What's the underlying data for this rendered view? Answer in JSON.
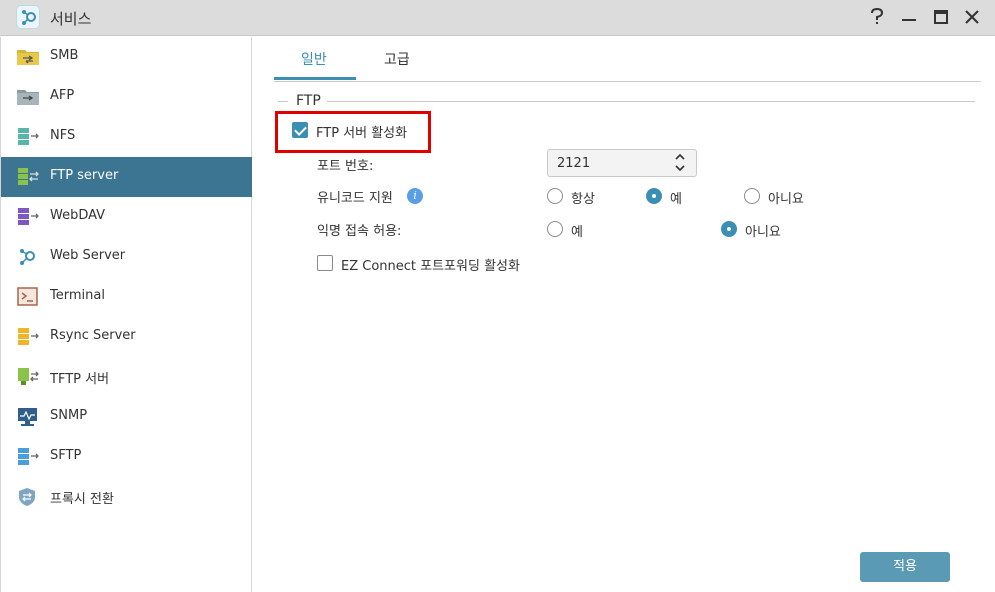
{
  "window": {
    "title": "서비스",
    "controls": [
      "help-icon",
      "minimize-icon",
      "maximize-icon",
      "close-icon"
    ]
  },
  "sidebar": {
    "items": [
      {
        "label": "SMB",
        "icon": "smb-folder-icon"
      },
      {
        "label": "AFP",
        "icon": "afp-folder-icon"
      },
      {
        "label": "NFS",
        "icon": "nfs-icon"
      },
      {
        "label": "FTP server",
        "icon": "ftp-icon",
        "active": true
      },
      {
        "label": "WebDAV",
        "icon": "webdav-icon"
      },
      {
        "label": "Web Server",
        "icon": "web-server-icon"
      },
      {
        "label": "Terminal",
        "icon": "terminal-icon"
      },
      {
        "label": "Rsync Server",
        "icon": "rsync-icon"
      },
      {
        "label": "TFTP 서버",
        "icon": "tftp-icon"
      },
      {
        "label": "SNMP",
        "icon": "snmp-icon"
      },
      {
        "label": "SFTP",
        "icon": "sftp-icon"
      },
      {
        "label": "프록시 전환",
        "icon": "proxy-shield-icon"
      }
    ]
  },
  "tabs": [
    {
      "label": "일반",
      "active": true
    },
    {
      "label": "고급",
      "active": false
    }
  ],
  "section": {
    "legend": "FTP",
    "enable_ftp": {
      "label": "FTP 서버 활성화",
      "checked": true
    },
    "port": {
      "label": "포트 번호:",
      "value": "2121"
    },
    "unicode": {
      "label": "유니코드 지원",
      "info_icon": "i",
      "options": [
        {
          "label": "항상",
          "selected": false
        },
        {
          "label": "예",
          "selected": true
        },
        {
          "label": "아니요",
          "selected": false
        }
      ]
    },
    "anonymous": {
      "label": "익명 접속 허용:",
      "options": [
        {
          "label": "예",
          "selected": false
        },
        {
          "label": "아니요",
          "selected": true
        }
      ]
    },
    "ez_connect": {
      "label": "EZ Connect 포트포워딩 활성화",
      "checked": false
    }
  },
  "footer": {
    "apply_label": "적용"
  },
  "colors": {
    "accent": "#3b8fb3",
    "sidebar_active": "#3b7591",
    "highlight": "#e10000",
    "button": "#5a9ab5"
  }
}
